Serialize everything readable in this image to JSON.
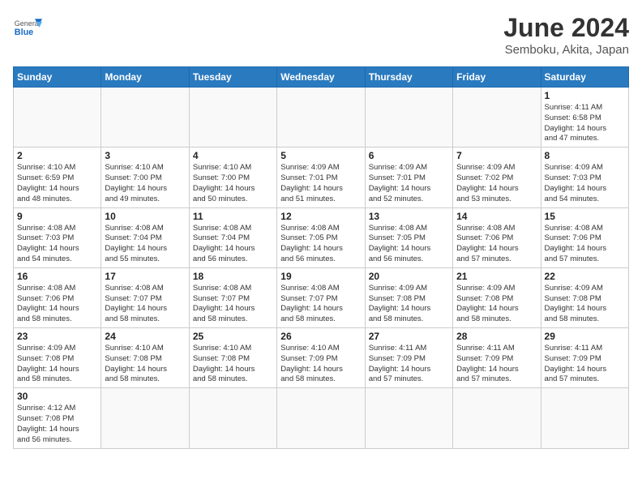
{
  "header": {
    "logo_line1": "General",
    "logo_line2": "Blue",
    "month_year": "June 2024",
    "location": "Semboku, Akita, Japan"
  },
  "weekdays": [
    "Sunday",
    "Monday",
    "Tuesday",
    "Wednesday",
    "Thursday",
    "Friday",
    "Saturday"
  ],
  "weeks": [
    [
      {
        "day": "",
        "info": ""
      },
      {
        "day": "",
        "info": ""
      },
      {
        "day": "",
        "info": ""
      },
      {
        "day": "",
        "info": ""
      },
      {
        "day": "",
        "info": ""
      },
      {
        "day": "",
        "info": ""
      },
      {
        "day": "1",
        "info": "Sunrise: 4:11 AM\nSunset: 6:58 PM\nDaylight: 14 hours\nand 47 minutes."
      }
    ],
    [
      {
        "day": "2",
        "info": "Sunrise: 4:10 AM\nSunset: 6:59 PM\nDaylight: 14 hours\nand 48 minutes."
      },
      {
        "day": "3",
        "info": "Sunrise: 4:10 AM\nSunset: 7:00 PM\nDaylight: 14 hours\nand 49 minutes."
      },
      {
        "day": "4",
        "info": "Sunrise: 4:10 AM\nSunset: 7:00 PM\nDaylight: 14 hours\nand 50 minutes."
      },
      {
        "day": "5",
        "info": "Sunrise: 4:09 AM\nSunset: 7:01 PM\nDaylight: 14 hours\nand 51 minutes."
      },
      {
        "day": "6",
        "info": "Sunrise: 4:09 AM\nSunset: 7:01 PM\nDaylight: 14 hours\nand 52 minutes."
      },
      {
        "day": "7",
        "info": "Sunrise: 4:09 AM\nSunset: 7:02 PM\nDaylight: 14 hours\nand 53 minutes."
      },
      {
        "day": "8",
        "info": "Sunrise: 4:09 AM\nSunset: 7:03 PM\nDaylight: 14 hours\nand 54 minutes."
      }
    ],
    [
      {
        "day": "9",
        "info": "Sunrise: 4:08 AM\nSunset: 7:03 PM\nDaylight: 14 hours\nand 54 minutes."
      },
      {
        "day": "10",
        "info": "Sunrise: 4:08 AM\nSunset: 7:04 PM\nDaylight: 14 hours\nand 55 minutes."
      },
      {
        "day": "11",
        "info": "Sunrise: 4:08 AM\nSunset: 7:04 PM\nDaylight: 14 hours\nand 56 minutes."
      },
      {
        "day": "12",
        "info": "Sunrise: 4:08 AM\nSunset: 7:05 PM\nDaylight: 14 hours\nand 56 minutes."
      },
      {
        "day": "13",
        "info": "Sunrise: 4:08 AM\nSunset: 7:05 PM\nDaylight: 14 hours\nand 56 minutes."
      },
      {
        "day": "14",
        "info": "Sunrise: 4:08 AM\nSunset: 7:06 PM\nDaylight: 14 hours\nand 57 minutes."
      },
      {
        "day": "15",
        "info": "Sunrise: 4:08 AM\nSunset: 7:06 PM\nDaylight: 14 hours\nand 57 minutes."
      }
    ],
    [
      {
        "day": "16",
        "info": "Sunrise: 4:08 AM\nSunset: 7:06 PM\nDaylight: 14 hours\nand 58 minutes."
      },
      {
        "day": "17",
        "info": "Sunrise: 4:08 AM\nSunset: 7:07 PM\nDaylight: 14 hours\nand 58 minutes."
      },
      {
        "day": "18",
        "info": "Sunrise: 4:08 AM\nSunset: 7:07 PM\nDaylight: 14 hours\nand 58 minutes."
      },
      {
        "day": "19",
        "info": "Sunrise: 4:08 AM\nSunset: 7:07 PM\nDaylight: 14 hours\nand 58 minutes."
      },
      {
        "day": "20",
        "info": "Sunrise: 4:09 AM\nSunset: 7:08 PM\nDaylight: 14 hours\nand 58 minutes."
      },
      {
        "day": "21",
        "info": "Sunrise: 4:09 AM\nSunset: 7:08 PM\nDaylight: 14 hours\nand 58 minutes."
      },
      {
        "day": "22",
        "info": "Sunrise: 4:09 AM\nSunset: 7:08 PM\nDaylight: 14 hours\nand 58 minutes."
      }
    ],
    [
      {
        "day": "23",
        "info": "Sunrise: 4:09 AM\nSunset: 7:08 PM\nDaylight: 14 hours\nand 58 minutes."
      },
      {
        "day": "24",
        "info": "Sunrise: 4:10 AM\nSunset: 7:08 PM\nDaylight: 14 hours\nand 58 minutes."
      },
      {
        "day": "25",
        "info": "Sunrise: 4:10 AM\nSunset: 7:08 PM\nDaylight: 14 hours\nand 58 minutes."
      },
      {
        "day": "26",
        "info": "Sunrise: 4:10 AM\nSunset: 7:09 PM\nDaylight: 14 hours\nand 58 minutes."
      },
      {
        "day": "27",
        "info": "Sunrise: 4:11 AM\nSunset: 7:09 PM\nDaylight: 14 hours\nand 57 minutes."
      },
      {
        "day": "28",
        "info": "Sunrise: 4:11 AM\nSunset: 7:09 PM\nDaylight: 14 hours\nand 57 minutes."
      },
      {
        "day": "29",
        "info": "Sunrise: 4:11 AM\nSunset: 7:09 PM\nDaylight: 14 hours\nand 57 minutes."
      }
    ],
    [
      {
        "day": "30",
        "info": "Sunrise: 4:12 AM\nSunset: 7:08 PM\nDaylight: 14 hours\nand 56 minutes."
      },
      {
        "day": "",
        "info": ""
      },
      {
        "day": "",
        "info": ""
      },
      {
        "day": "",
        "info": ""
      },
      {
        "day": "",
        "info": ""
      },
      {
        "day": "",
        "info": ""
      },
      {
        "day": "",
        "info": ""
      }
    ]
  ]
}
